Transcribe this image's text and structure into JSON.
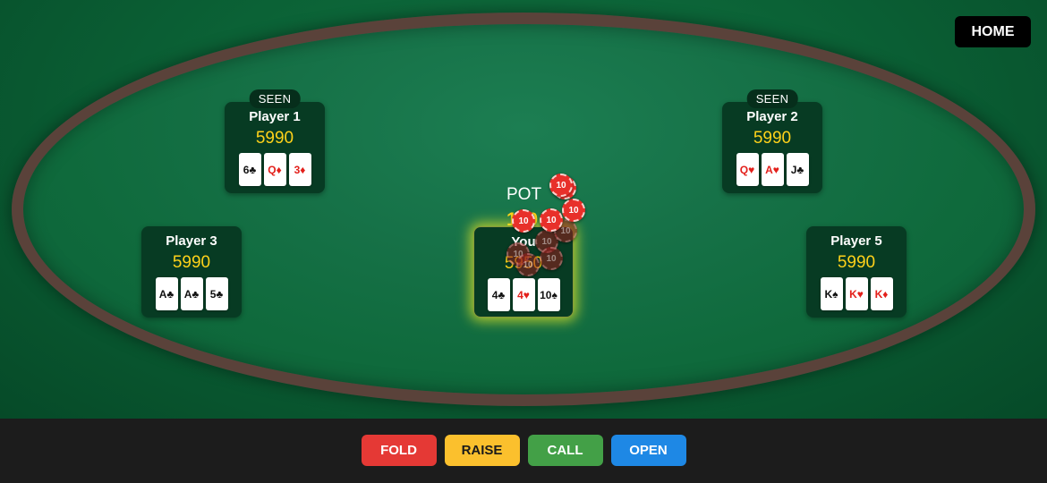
{
  "header": {
    "home_label": "HOME"
  },
  "pot": {
    "label": "POT",
    "value": "100"
  },
  "players": [
    {
      "name": "Player 1",
      "chips": "5990",
      "status": "SEEN",
      "cards": [
        {
          "text": "6♣",
          "color": "black"
        },
        {
          "text": "Q♦",
          "color": "red"
        },
        {
          "text": "3♦",
          "color": "red"
        }
      ]
    },
    {
      "name": "Player 2",
      "chips": "5990",
      "status": "SEEN",
      "cards": [
        {
          "text": "Q♥",
          "color": "red"
        },
        {
          "text": "A♥",
          "color": "red"
        },
        {
          "text": "J♣",
          "color": "black"
        }
      ]
    },
    {
      "name": "Player 3",
      "chips": "5990",
      "cards": [
        {
          "text": "A♣",
          "color": "black"
        },
        {
          "text": "A♣",
          "color": "black"
        },
        {
          "text": "5♣",
          "color": "black"
        }
      ]
    },
    {
      "name": "You",
      "chips": "5950",
      "cards": [
        {
          "text": "4♣",
          "color": "black"
        },
        {
          "text": "4♥",
          "color": "red"
        },
        {
          "text": "10♠",
          "color": "black"
        }
      ]
    },
    {
      "name": "Player 5",
      "chips": "5990",
      "cards": [
        {
          "text": "K♠",
          "color": "black"
        },
        {
          "text": "K♥",
          "color": "red"
        },
        {
          "text": "K♦",
          "color": "red"
        }
      ]
    }
  ],
  "chips_on_table": {
    "denomination": "10",
    "count": 10,
    "color": "#e8302a"
  },
  "actions": {
    "fold": "FOLD",
    "raise": "RAISE",
    "call": "CALL",
    "open": "OPEN"
  },
  "colors": {
    "felt": "#167147",
    "rim": "#5a423a",
    "chip_amount": "#ffd21a",
    "highlight": "#e6e628"
  }
}
